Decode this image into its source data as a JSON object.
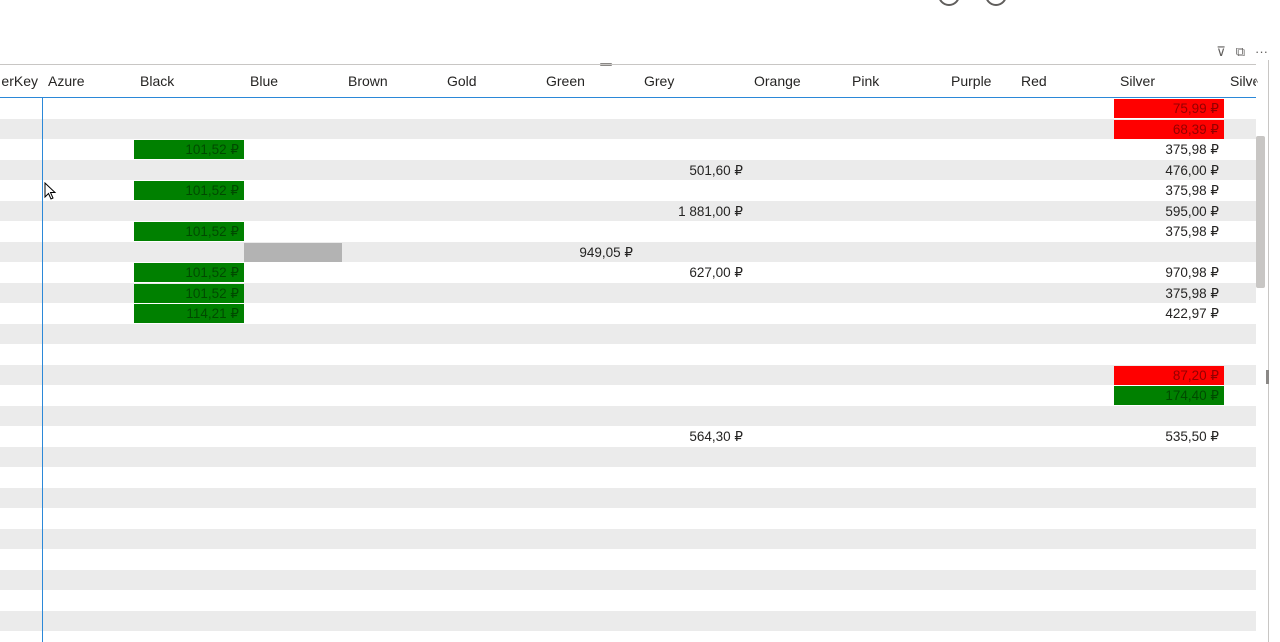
{
  "colors": {
    "cf_red": "#ff0000",
    "cf_green": "#008000",
    "cf_grey": "#b3b3b3",
    "row_alt": "#ebebeb",
    "focus_blue": "#2b88d8"
  },
  "visual_header": {
    "icons": [
      "filter-icon",
      "focus-mode-icon",
      "more-options-icon"
    ],
    "filter_glyph": "⊽",
    "focus_glyph": "⧉",
    "more_glyph": "···"
  },
  "scroll_up_glyph": "^",
  "columns": [
    {
      "key": "first",
      "label": "erKey"
    },
    {
      "key": "azure",
      "label": "Azure"
    },
    {
      "key": "black",
      "label": "Black"
    },
    {
      "key": "blue",
      "label": "Blue"
    },
    {
      "key": "brown",
      "label": "Brown"
    },
    {
      "key": "gold",
      "label": "Gold"
    },
    {
      "key": "green",
      "label": "Green"
    },
    {
      "key": "grey",
      "label": "Grey"
    },
    {
      "key": "orange",
      "label": "Orange"
    },
    {
      "key": "pink",
      "label": "Pink"
    },
    {
      "key": "purple",
      "label": "Purple"
    },
    {
      "key": "red",
      "label": "Red"
    },
    {
      "key": "silver",
      "label": "Silver"
    },
    {
      "key": "silver2",
      "label": "Silve"
    }
  ],
  "rows": [
    {
      "silver": {
        "v": "75,99 ₽",
        "bg": "red"
      }
    },
    {
      "silver": {
        "v": "68,39 ₽",
        "bg": "red"
      }
    },
    {
      "black": {
        "v": "101,52 ₽",
        "bg": "green"
      },
      "silver": {
        "v": "375,98 ₽"
      }
    },
    {
      "grey": {
        "v": "501,60 ₽"
      },
      "silver": {
        "v": "476,00 ₽"
      }
    },
    {
      "black": {
        "v": "101,52 ₽",
        "bg": "green"
      },
      "silver": {
        "v": "375,98 ₽"
      }
    },
    {
      "grey": {
        "v": "1 881,00 ₽"
      },
      "silver": {
        "v": "595,00 ₽"
      }
    },
    {
      "black": {
        "v": "101,52 ₽",
        "bg": "green"
      },
      "silver": {
        "v": "375,98 ₽"
      }
    },
    {
      "blue": {
        "v": "",
        "bg": "grey"
      },
      "green": {
        "v": "949,05 ₽"
      }
    },
    {
      "black": {
        "v": "101,52 ₽",
        "bg": "green"
      },
      "grey": {
        "v": "627,00 ₽"
      },
      "silver": {
        "v": "970,98 ₽"
      }
    },
    {
      "black": {
        "v": "101,52 ₽",
        "bg": "green"
      },
      "silver": {
        "v": "375,98 ₽"
      }
    },
    {
      "black": {
        "v": "114,21 ₽",
        "bg": "green"
      },
      "silver": {
        "v": "422,97 ₽"
      }
    },
    {},
    {},
    {
      "silver": {
        "v": "87,20 ₽",
        "bg": "red"
      }
    },
    {
      "silver": {
        "v": "174,40 ₽",
        "bg": "green"
      }
    },
    {},
    {
      "grey": {
        "v": "564,30 ₽"
      },
      "silver": {
        "v": "535,50 ₽"
      }
    },
    {},
    {},
    {},
    {},
    {},
    {},
    {},
    {},
    {},
    {}
  ]
}
